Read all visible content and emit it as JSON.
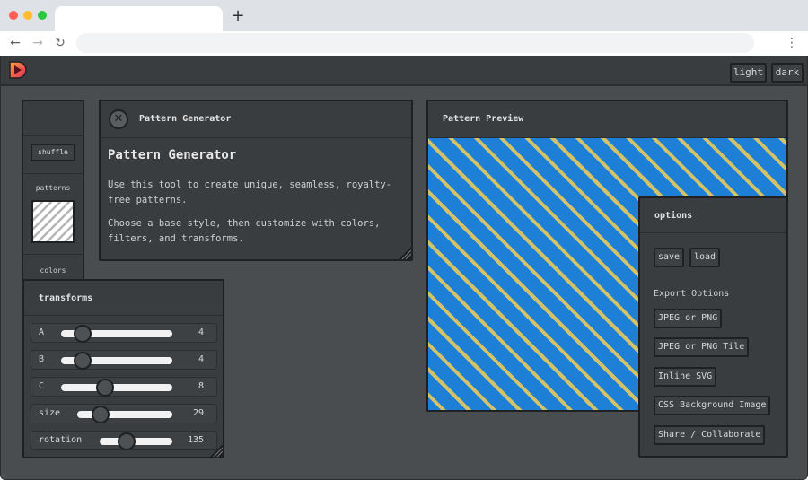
{
  "browser": {
    "new_tab": "+",
    "back": "←",
    "forward": "→",
    "reload": "↻",
    "menu": "⋮"
  },
  "header": {
    "light_label": "light",
    "dark_label": "dark"
  },
  "sidebar": {
    "shuffle_label": "shuffle",
    "patterns_label": "patterns",
    "colors_label": "colors"
  },
  "generator": {
    "panel_title": "Pattern Generator",
    "close_glyph": "✕",
    "heading": "Pattern Generator",
    "paragraph1": "Use this tool to create unique, seamless, royalty-free patterns.",
    "paragraph2": "Choose a base style, then customize with colors, filters, and transforms."
  },
  "transforms": {
    "title": "transforms",
    "rows": [
      {
        "label": "A",
        "value": "4",
        "level": 0.15
      },
      {
        "label": "B",
        "value": "4",
        "level": 0.15
      },
      {
        "label": "C",
        "value": "8",
        "level": 0.4
      },
      {
        "label": "size",
        "value": "29",
        "level": 0.25
      },
      {
        "label": "rotation",
        "value": "135",
        "level": 0.38
      }
    ]
  },
  "preview": {
    "title": "Pattern Preview",
    "stripe_color": "#1e7fd6",
    "line_color": "#d2c26a"
  },
  "options": {
    "title": "options",
    "save_label": "save",
    "load_label": "load",
    "export_label": "Export Options",
    "export_buttons": [
      "JPEG or PNG",
      "JPEG or PNG Tile",
      "Inline SVG",
      "CSS Background Image",
      "Share / Collaborate"
    ]
  },
  "colors": {
    "app_bg": "#4a4d50",
    "panel_bg": "#3a3d40",
    "border": "#1e2022"
  }
}
